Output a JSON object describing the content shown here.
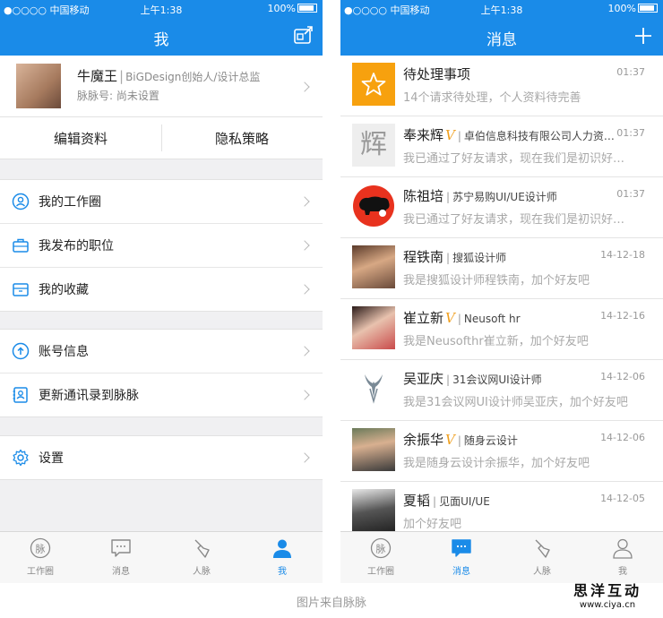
{
  "colors": {
    "accent": "#1a8be8",
    "vip": "#f0a020"
  },
  "status_bar": {
    "carrier": "●○○○○ 中国移动",
    "time": "上午1:38",
    "battery": "100%"
  },
  "left_screen": {
    "title": "我",
    "profile": {
      "name": "牛魔王",
      "title": "BiGDesign创始人/设计总监",
      "maimai_id": "脉脉号: 尚未设置"
    },
    "actions": {
      "edit_profile": "编辑资料",
      "privacy": "隐私策略"
    },
    "group1": [
      {
        "label": "我的工作圈",
        "icon": "user-circle-icon"
      },
      {
        "label": "我发布的职位",
        "icon": "briefcase-icon"
      },
      {
        "label": "我的收藏",
        "icon": "archive-box-icon"
      }
    ],
    "group2": [
      {
        "label": "账号信息",
        "icon": "arrow-up-circle-icon"
      },
      {
        "label": "更新通讯录到脉脉",
        "icon": "contacts-book-icon"
      }
    ],
    "group3": [
      {
        "label": "设置",
        "icon": "gear-icon"
      }
    ]
  },
  "right_screen": {
    "title": "消息",
    "messages": [
      {
        "name": "待处理事项",
        "vip": "",
        "company": "",
        "time": "01:37",
        "text": "14个请求待处理，个人资料待完善"
      },
      {
        "name": "奉来辉",
        "vip": "V",
        "company": "卓伯信息科技有限公司人力资…",
        "time": "01:37",
        "text": "我已通过了好友请求，现在我们是初识好…",
        "avatar_char": "辉"
      },
      {
        "name": "陈祖培",
        "vip": "",
        "company": "苏宁易购UI/UE设计师",
        "time": "01:37",
        "text": "我已通过了好友请求，现在我们是初识好…"
      },
      {
        "name": "程铁南",
        "vip": "",
        "company": "搜狐设计师",
        "time": "14-12-18",
        "text": "我是搜狐设计师程铁南，加个好友吧"
      },
      {
        "name": "崔立新",
        "vip": "V",
        "company": "Neusoft hr",
        "time": "14-12-16",
        "text": "我是Neusofthr崔立新，加个好友吧"
      },
      {
        "name": "吴亚庆",
        "vip": "",
        "company": "31会议网UI设计师",
        "time": "14-12-06",
        "text": "我是31会议网UI设计师吴亚庆，加个好友吧"
      },
      {
        "name": "余振华",
        "vip": "V",
        "company": "随身云设计",
        "time": "14-12-06",
        "text": "我是随身云设计余振华，加个好友吧"
      },
      {
        "name": "夏韬",
        "vip": "",
        "company": "见面UI/UE",
        "time": "14-12-05",
        "text": "加个好友吧"
      }
    ]
  },
  "tabs": [
    "工作圈",
    "消息",
    "人脉",
    "我"
  ],
  "caption": "图片来自脉脉",
  "watermark": {
    "line1": "思洋互动",
    "line2": "www.ciya.cn"
  }
}
